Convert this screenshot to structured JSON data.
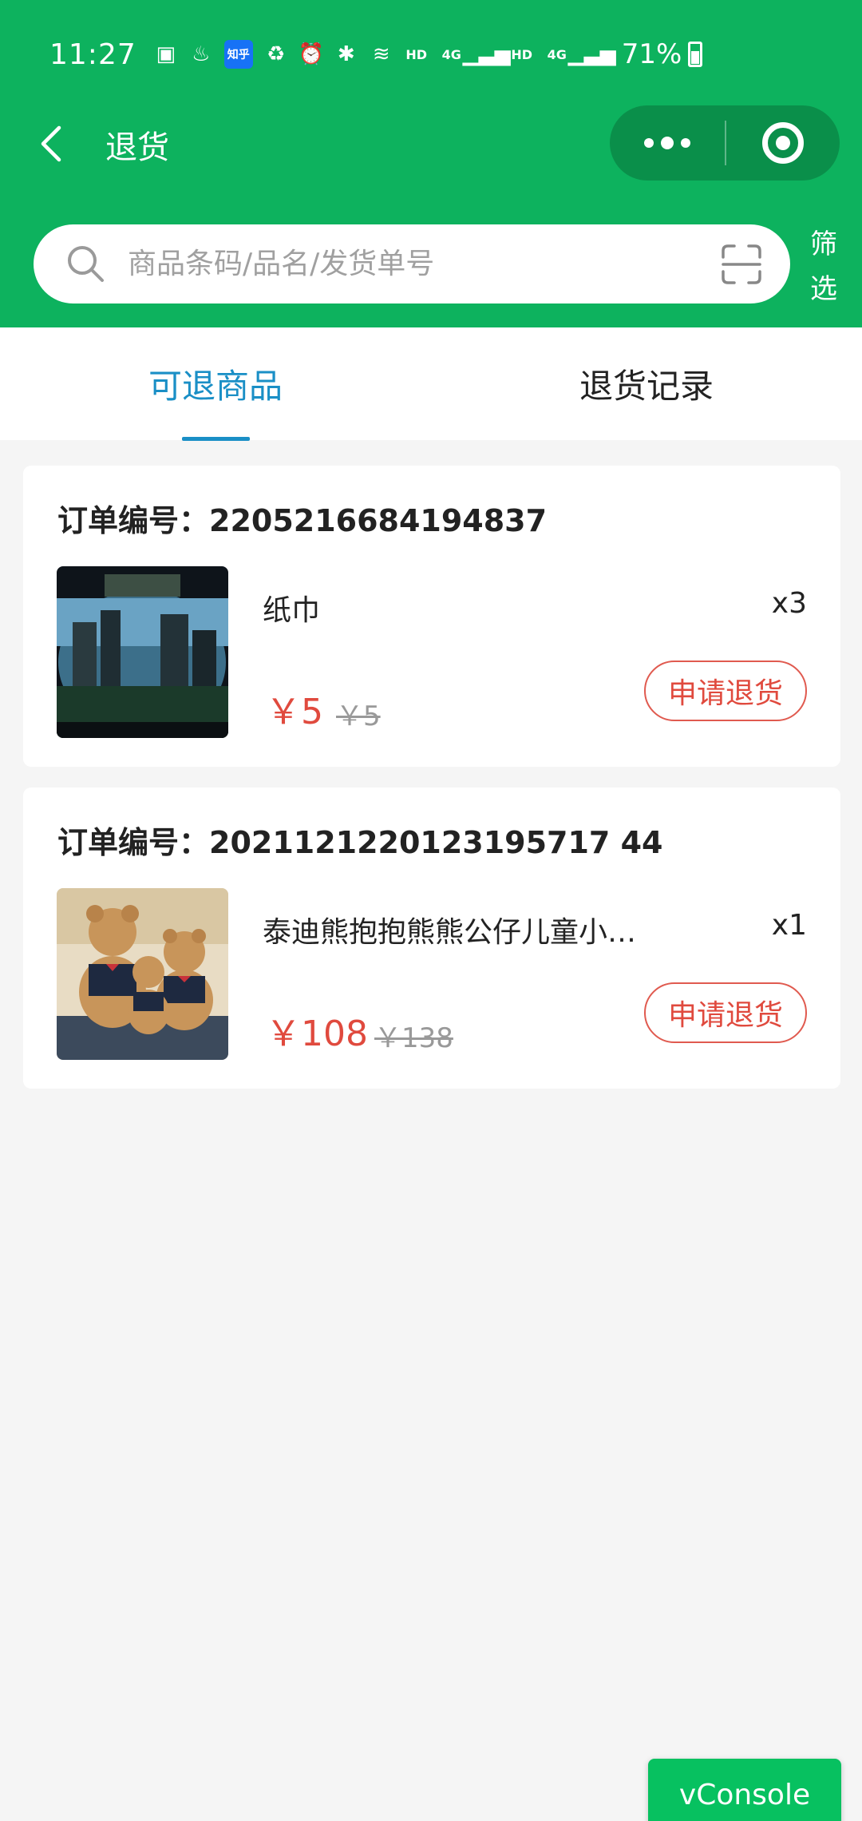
{
  "status_bar": {
    "time": "11:27",
    "zhihu_label": "知乎",
    "hd1": "HD",
    "net1": "4G",
    "hd2": "HD",
    "net2": "4G",
    "battery": "71%"
  },
  "navbar": {
    "title": "退货"
  },
  "search": {
    "placeholder": "商品条码/品名/发货单号",
    "filter_label": "筛选"
  },
  "tabs": [
    {
      "label": "可退商品",
      "active": true
    },
    {
      "label": "退货记录",
      "active": false
    }
  ],
  "orders": [
    {
      "order_no": "订单编号：2205216684194837",
      "item_name": "纸巾",
      "qty": "x3",
      "price": "￥5",
      "orig_price": "￥5",
      "button": "申请退货"
    },
    {
      "order_no": "订单编号：2021121220123195717 44",
      "item_name": "泰迪熊抱抱熊熊公仔儿童小…",
      "qty": "x1",
      "price": "￥108",
      "orig_price": "￥138",
      "button": "申请退货"
    }
  ],
  "vconsole": "vConsole",
  "colors": {
    "header_green": "#0db25e",
    "tab_active": "#1a8fc6",
    "price_red": "#e04a3e",
    "vconsole_green": "#07c160"
  }
}
